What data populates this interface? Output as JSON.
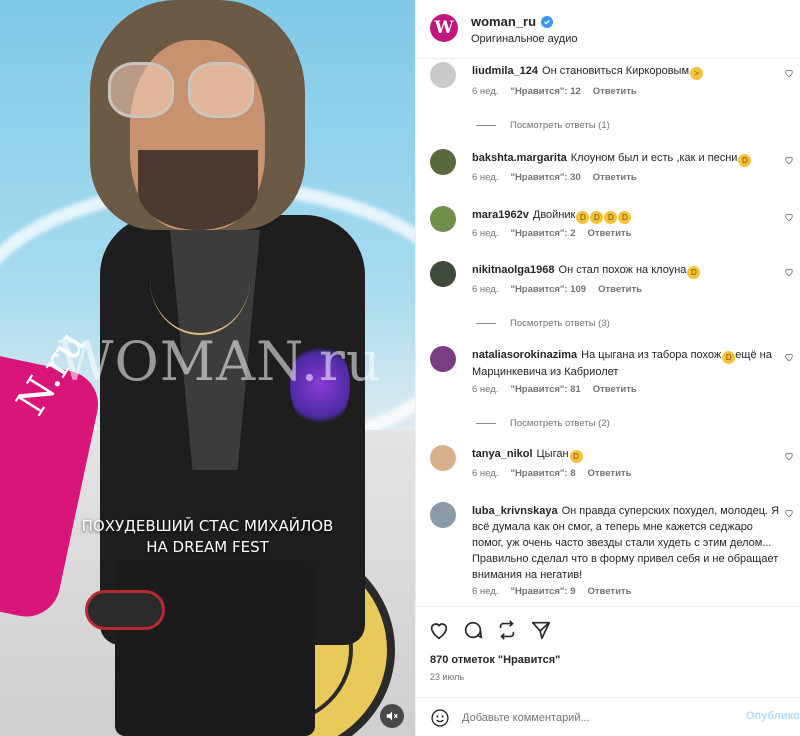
{
  "media": {
    "watermark": "WOMAN.ru",
    "sign_text": "N.ru",
    "caption_line1": "ПОХУДЕВШИЙ СТАС МИХАЙЛОВ",
    "caption_line2": "НА DREAM FEST",
    "mute_icon": "speaker-muted-icon"
  },
  "header": {
    "logo_letter": "W",
    "username": "woman_ru",
    "verified": true,
    "audio": "Оригинальное аудио"
  },
  "comments": [
    {
      "user": "liudmila_124",
      "text": "Он становиться Киркоровым",
      "emoji": [
        "angry"
      ],
      "age": "6 нед.",
      "likes": "\"Нравится\": 12",
      "reply": "Ответить",
      "view_replies": "Посмотреть ответы (1)",
      "avatar_color": "#c9c9c9"
    },
    {
      "user": "bakshta.margarita",
      "text": "Клоуном был и есть ,как и песни",
      "emoji": [
        "laugh"
      ],
      "age": "6 нед.",
      "likes": "\"Нравится\": 30",
      "reply": "Ответить",
      "view_replies": "",
      "avatar_color": "#5a6a3c"
    },
    {
      "user": "mara1962v",
      "text": "Двойник",
      "emoji": [
        "laugh",
        "laugh",
        "laugh",
        "laugh"
      ],
      "age": "6 нед.",
      "likes": "\"Нравится\": 2",
      "reply": "Ответить",
      "view_replies": "",
      "avatar_color": "#6f8f4a"
    },
    {
      "user": "nikitnaolga1968",
      "text": "Он стал похож на клоуна",
      "emoji": [
        "laugh"
      ],
      "age": "6 нед.",
      "likes": "\"Нравится\": 109",
      "reply": "Ответить",
      "view_replies": "Посмотреть ответы (3)",
      "avatar_color": "#3f4a3a"
    },
    {
      "user": "nataliasorokinazima",
      "text": "На цыгана из табора похож",
      "text2": "ещё на Марцинкевича из Кабриолет",
      "emoji": [
        "grin"
      ],
      "age": "6 нед.",
      "likes": "\"Нравится\": 81",
      "reply": "Ответить",
      "view_replies": "Посмотреть ответы (2)",
      "avatar_color": "#7a3c82"
    },
    {
      "user": "tanya_nikol",
      "text": "Цыган",
      "emoji": [
        "laugh"
      ],
      "age": "6 нед.",
      "likes": "\"Нравится\": 8",
      "reply": "Ответить",
      "view_replies": "",
      "avatar_color": "#d8b08a"
    },
    {
      "user": "luba_krivnskaya",
      "text": "Он правда суперских похудел, молодец. Я всё думала как он смог, а теперь мне кажется седжаро помог, уж очень часто звезды стали худеть с этим делом... Правильно сделал что в форму привел себя и не обращает внимания на негатив!",
      "emoji": [],
      "age": "6 нед.",
      "likes": "\"Нравится\": 9",
      "reply": "Ответить",
      "view_replies": "",
      "avatar_color": "#8a9aa8"
    }
  ],
  "likes_count": "870 отметок \"Нравится\"",
  "date": "23 июль",
  "add_comment": {
    "placeholder": "Добавьте комментарий...",
    "post_label": "Опублико"
  },
  "colors": {
    "brand": "#c0167d",
    "verified": "#3897f0",
    "post_disabled": "#b3dbff"
  }
}
